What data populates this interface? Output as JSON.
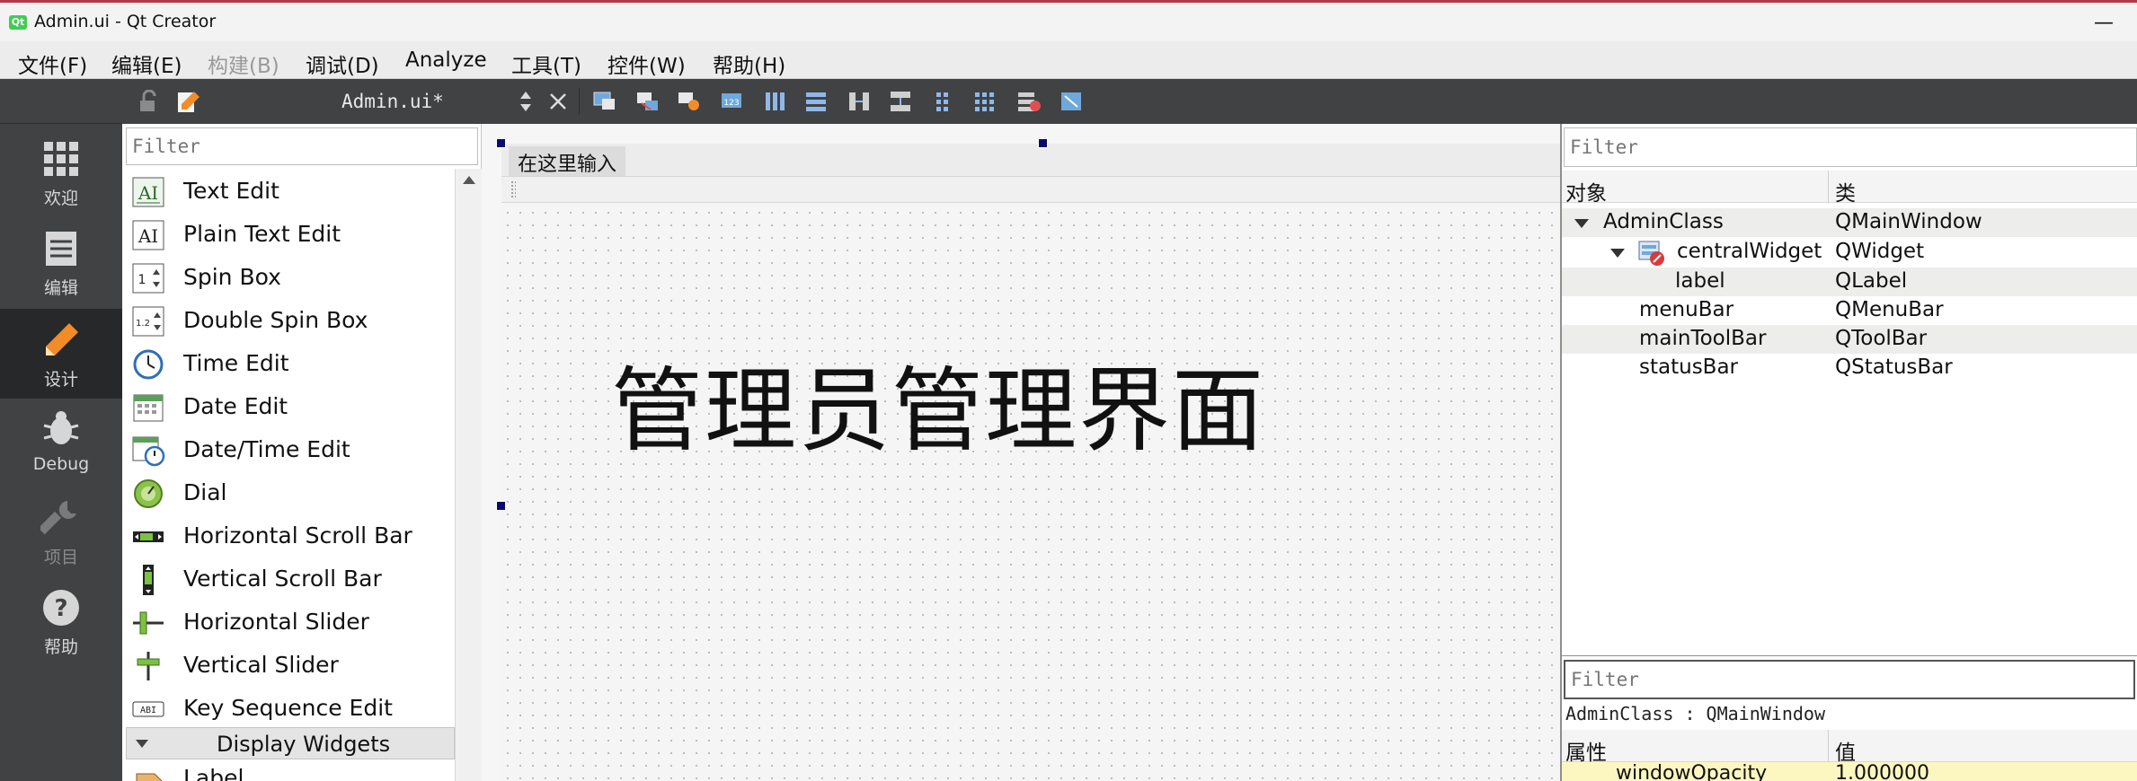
{
  "window": {
    "title": "Admin.ui - Qt Creator",
    "app_icon": "qt-logo-icon",
    "app_icon_text": "Qt",
    "minimize_glyph": "—"
  },
  "menubar": {
    "items": [
      {
        "label": "文件(F)",
        "enabled": true
      },
      {
        "label": "编辑(E)",
        "enabled": true
      },
      {
        "label": "构建(B)",
        "enabled": false
      },
      {
        "label": "调试(D)",
        "enabled": true
      },
      {
        "label": "Analyze",
        "enabled": true
      },
      {
        "label": "工具(T)",
        "enabled": true
      },
      {
        "label": "控件(W)",
        "enabled": true
      },
      {
        "label": "帮助(H)",
        "enabled": true
      }
    ]
  },
  "modes": [
    {
      "label": "欢迎",
      "icon": "grid-icon",
      "active": false,
      "enabled": true
    },
    {
      "label": "编辑",
      "icon": "document-icon",
      "active": false,
      "enabled": true
    },
    {
      "label": "设计",
      "icon": "pencil-icon",
      "active": true,
      "enabled": true
    },
    {
      "label": "Debug",
      "icon": "bug-icon",
      "active": false,
      "enabled": true
    },
    {
      "label": "项目",
      "icon": "wrench-icon",
      "active": false,
      "enabled": false
    },
    {
      "label": "帮助",
      "icon": "help-icon",
      "active": false,
      "enabled": true
    }
  ],
  "editor_toolbar": {
    "file_name": "Admin.ui*",
    "icons": [
      "lock-icon",
      "edit-file-icon",
      "split-arrows-icon",
      "close-icon",
      "edit-widgets-icon",
      "edit-signals-slots-icon",
      "edit-buddies-icon",
      "edit-tab-order-icon",
      "layout-horizontal-icon",
      "layout-vertical-icon",
      "layout-h-splitter-icon",
      "layout-v-splitter-icon",
      "layout-form-icon",
      "layout-grid-icon",
      "break-layout-icon",
      "adjust-size-icon"
    ]
  },
  "widget_box": {
    "filter_placeholder": "Filter",
    "items": [
      {
        "label": "Text Edit",
        "icon": "text-edit-icon"
      },
      {
        "label": "Plain Text Edit",
        "icon": "plain-text-edit-icon"
      },
      {
        "label": "Spin Box",
        "icon": "spin-box-icon"
      },
      {
        "label": "Double Spin Box",
        "icon": "double-spin-box-icon"
      },
      {
        "label": "Time Edit",
        "icon": "clock-icon"
      },
      {
        "label": "Date Edit",
        "icon": "calendar-icon"
      },
      {
        "label": "Date/Time Edit",
        "icon": "calendar-clock-icon"
      },
      {
        "label": "Dial",
        "icon": "dial-icon"
      },
      {
        "label": "Horizontal Scroll Bar",
        "icon": "hscrollbar-icon"
      },
      {
        "label": "Vertical Scroll Bar",
        "icon": "vscrollbar-icon"
      },
      {
        "label": "Horizontal Slider",
        "icon": "hslider-icon"
      },
      {
        "label": "Vertical Slider",
        "icon": "vslider-icon"
      },
      {
        "label": "Key Sequence Edit",
        "icon": "key-sequence-icon"
      }
    ],
    "category": "Display Widgets",
    "partial_item": "Label"
  },
  "form": {
    "menu_placeholder": "在这里输入",
    "label_text": "管理员管理界面"
  },
  "object_inspector": {
    "filter_placeholder": "Filter",
    "col_object": "对象",
    "col_class": "类",
    "rows": [
      {
        "name": "AdminClass",
        "cls": "QMainWindow"
      },
      {
        "name": "centralWidget",
        "cls": "QWidget"
      },
      {
        "name": "label",
        "cls": "QLabel"
      },
      {
        "name": "menuBar",
        "cls": "QMenuBar"
      },
      {
        "name": "mainToolBar",
        "cls": "QToolBar"
      },
      {
        "name": "statusBar",
        "cls": "QStatusBar"
      }
    ]
  },
  "property_editor": {
    "filter_placeholder": "Filter",
    "context": "AdminClass : QMainWindow",
    "col_property": "属性",
    "col_value": "值",
    "first_row": {
      "name": "windowOpacity",
      "value": "1.000000"
    }
  }
}
